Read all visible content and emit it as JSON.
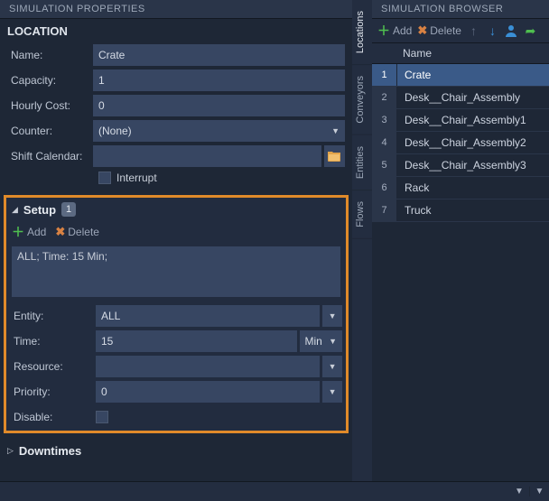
{
  "leftPanel": {
    "header": "SIMULATION PROPERTIES",
    "section": "LOCATION",
    "fields": {
      "name": {
        "label": "Name:",
        "value": "Crate"
      },
      "capacity": {
        "label": "Capacity:",
        "value": "1"
      },
      "hourlyCost": {
        "label": "Hourly Cost:",
        "value": "0"
      },
      "counter": {
        "label": "Counter:",
        "value": "(None)"
      },
      "shiftCalendar": {
        "label": "Shift Calendar:",
        "value": ""
      },
      "interrupt": {
        "label": "Interrupt"
      }
    },
    "setup": {
      "title": "Setup",
      "count": "1",
      "addLabel": "Add",
      "deleteLabel": "Delete",
      "listItem": "ALL; Time: 15 Min;",
      "fields": {
        "entity": {
          "label": "Entity:",
          "value": "ALL"
        },
        "time": {
          "label": "Time:",
          "value": "15",
          "unit": "Min"
        },
        "resource": {
          "label": "Resource:",
          "value": ""
        },
        "priority": {
          "label": "Priority:",
          "value": "0"
        },
        "disable": {
          "label": "Disable:"
        }
      }
    },
    "downtimes": {
      "title": "Downtimes"
    }
  },
  "rightPanel": {
    "header": "SIMULATION BROWSER",
    "toolbar": {
      "addLabel": "Add",
      "deleteLabel": "Delete"
    },
    "columns": {
      "name": "Name"
    },
    "rows": [
      {
        "n": "1",
        "name": "Crate",
        "selected": true
      },
      {
        "n": "2",
        "name": "Desk__Chair_Assembly"
      },
      {
        "n": "3",
        "name": "Desk__Chair_Assembly1"
      },
      {
        "n": "4",
        "name": "Desk__Chair_Assembly2"
      },
      {
        "n": "5",
        "name": "Desk__Chair_Assembly3"
      },
      {
        "n": "6",
        "name": "Rack"
      },
      {
        "n": "7",
        "name": "Truck"
      }
    ],
    "tabs": [
      "Locations",
      "Conveyors",
      "Entities",
      "Flows"
    ]
  }
}
